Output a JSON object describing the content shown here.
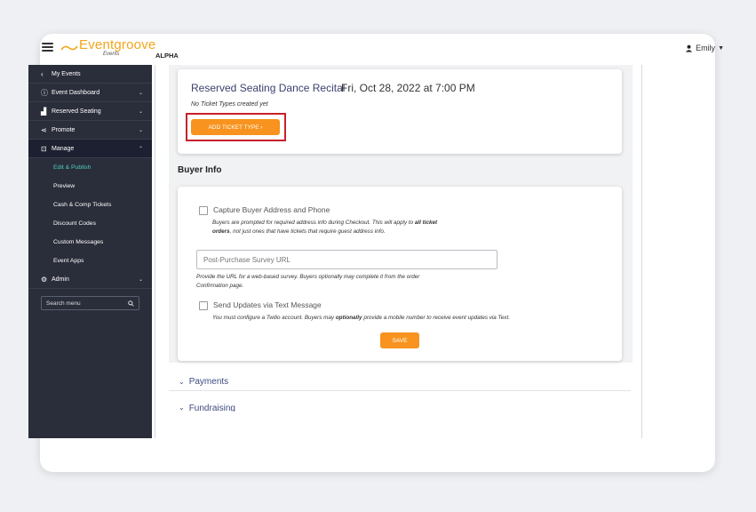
{
  "header": {
    "logo_name": "Eventgroove",
    "logo_sub": "Events",
    "logo_badge": "ALPHA",
    "user_name": "Emily"
  },
  "sidebar": {
    "back_label": "My Events",
    "items": [
      {
        "label": "Event Dashboard",
        "icon": "info-icon"
      },
      {
        "label": "Reserved Seating",
        "icon": "seat-icon"
      },
      {
        "label": "Promote",
        "icon": "share-icon"
      },
      {
        "label": "Manage",
        "icon": "manage-icon"
      }
    ],
    "sub_items": [
      "Edit & Publish",
      "Preview",
      "Cash & Comp Tickets",
      "Discount Codes",
      "Custom Messages",
      "Event Apps"
    ],
    "admin_label": "Admin",
    "search_placeholder": "Search menu"
  },
  "event": {
    "title": "Reserved Seating Dance Recital",
    "date": "Fri, Oct 28, 2022 at 7:00 PM",
    "no_types": "No Ticket Types created yet",
    "add_button": "ADD TICKET TYPE  ›"
  },
  "buyer_info": {
    "heading": "Buyer Info",
    "capture_label": "Capture Buyer Address and Phone",
    "capture_help_1a": "Buyers are prompted for required address info during Checkout. This will apply to ",
    "capture_help_1b": "all ticket",
    "capture_help_2a": "orders",
    "capture_help_2b": ", not just ones that have tickets that require guest address info.",
    "survey_placeholder": "Post-Purchase Survey URL",
    "survey_help_1": "Provide the URL for a web-based survey. Buyers optionally may complete it from the order",
    "survey_help_2": "Confirmation page.",
    "sms_label": "Send Updates via Text Message",
    "sms_help_a": "You must configure a Twilio account. Buyers may ",
    "sms_help_b": "optionally",
    "sms_help_c": " provide a mobile number to receive event updates via Text.",
    "save_label": "SAVE"
  },
  "sections": {
    "payments": "Payments",
    "fundraising": "Fundraising"
  },
  "colors": {
    "accent": "#f7931e",
    "sidebar": "#2a2d3a",
    "highlight": "#c8202b",
    "active_link": "#4fd1c5"
  }
}
